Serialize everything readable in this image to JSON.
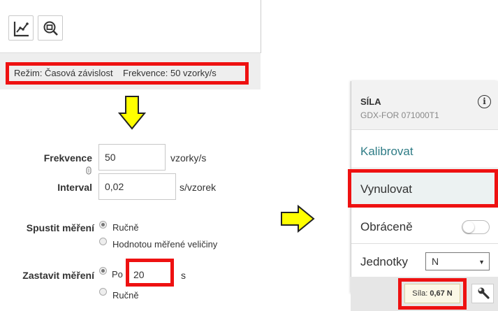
{
  "toolbar": {
    "graph_tool": "graph-icon",
    "zoom_tool": "zoom-icon"
  },
  "mode_bar": {
    "text": "Režim: Časová závislost    Frekvence: 50 vzorky/s"
  },
  "settings": {
    "frequency_label": "Frekvence",
    "frequency_value": "50",
    "frequency_unit": "vzorky/s",
    "interval_label": "Interval",
    "interval_value": "0,02",
    "interval_unit": "s/vzorek",
    "start_label": "Spustit měření",
    "start_options": [
      "Ručně",
      "Hodnotou měřené veličiny"
    ],
    "start_selected": "Ručně",
    "stop_label": "Zastavit měření",
    "stop_option_after": "Po",
    "stop_value": "20",
    "stop_unit": "s",
    "stop_option_manual": "Ručně",
    "stop_selected": "Po"
  },
  "sensor_panel": {
    "name": "SÍLA",
    "id": "GDX-FOR 071000T1",
    "info_icon": "i",
    "menu": {
      "calibrate": "Kalibrovat",
      "zero": "Vynulovat",
      "reverse": "Obráceně",
      "units": "Jednotky"
    },
    "reverse_on": false,
    "units_value": "N",
    "units_caret": "▼"
  },
  "meter": {
    "label": "Síla:",
    "value": "0,67 N"
  },
  "colors": {
    "highlight_red": "#ee1111",
    "arrow_yellow": "#ffff00",
    "teal": "#2f7c86"
  }
}
